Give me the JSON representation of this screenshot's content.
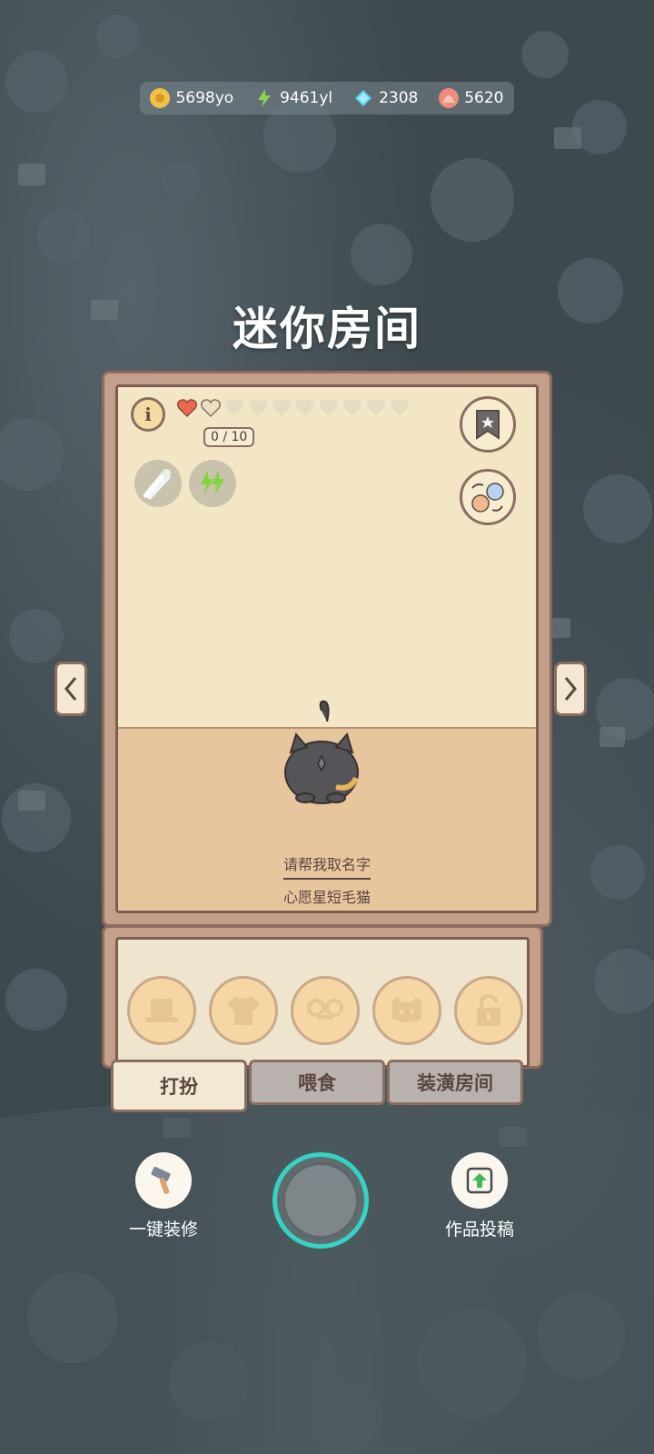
{
  "resources": [
    {
      "name": "coin",
      "value": "5698yo",
      "color": "#f1c24a",
      "icon": "coin-icon"
    },
    {
      "name": "energy",
      "value": "9461yl",
      "color": "#8ed24f",
      "icon": "lightning-icon"
    },
    {
      "name": "gem",
      "value": "2308",
      "color": "#5fd0e8",
      "icon": "gem-icon"
    },
    {
      "name": "shell",
      "value": "5620",
      "color": "#f08a7b",
      "icon": "shell-icon"
    }
  ],
  "title": "迷你房间",
  "room": {
    "love_progress": "0 / 10",
    "hearts_total": 10,
    "hearts_filled": 1,
    "cat_name": "请帮我取名字",
    "cat_breed": "心愿星短毛猫"
  },
  "tabs": [
    {
      "label": "打扮",
      "active": true
    },
    {
      "label": "喂食",
      "active": false
    },
    {
      "label": "装潢房间",
      "active": false
    }
  ],
  "outfit_slots": [
    "hat-icon",
    "shirt-icon",
    "glasses-icon",
    "face-icon",
    "lock-icon"
  ],
  "actions": {
    "decorate_label": "一键装修",
    "submit_label": "作品投稿"
  },
  "colors": {
    "accent_ring": "#34d3c4",
    "panel_border": "#8a6e5f"
  }
}
